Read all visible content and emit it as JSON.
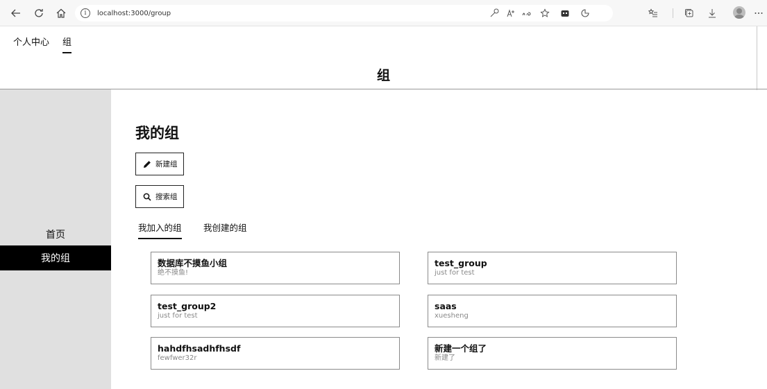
{
  "browser": {
    "url": "localhost:3000/group"
  },
  "top_nav": {
    "items": [
      "个人中心",
      "组"
    ],
    "active_index": 1
  },
  "page_title": "组",
  "sidebar": {
    "items": [
      "首页",
      "我的组"
    ],
    "active_index": 1
  },
  "main": {
    "section_title": "我的组",
    "new_group_label": "新建组",
    "search_group_label": "搜索组",
    "tabs": [
      "我加入的组",
      "我创建的组"
    ],
    "active_tab": 0,
    "groups": [
      {
        "name": "数据库不摸鱼小组",
        "desc": "绝不摸鱼!"
      },
      {
        "name": "test_group",
        "desc": "just for test"
      },
      {
        "name": "test_group2",
        "desc": "just for test"
      },
      {
        "name": "saas",
        "desc": "xuesheng"
      },
      {
        "name": "hahdfhsadhfhsdf",
        "desc": "fewfwer32r"
      },
      {
        "name": "新建一个组了",
        "desc": "新建了"
      }
    ]
  },
  "icons": {
    "back": "back-arrow-icon",
    "refresh": "refresh-icon",
    "home": "home-icon",
    "info": "info-icon",
    "new_group": "pencil-icon",
    "search_group": "search-icon"
  }
}
